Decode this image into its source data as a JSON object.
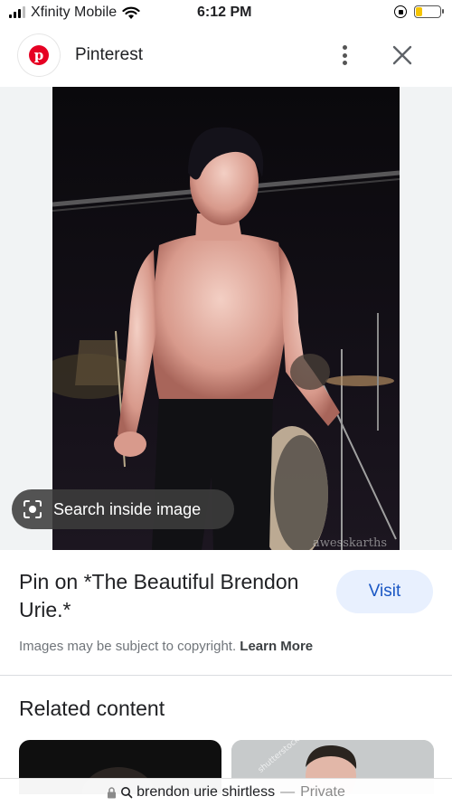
{
  "status_bar": {
    "carrier": "Xfinity Mobile",
    "time": "6:12 PM",
    "battery_level": 0.25,
    "signal_bars": 3
  },
  "header": {
    "app_name": "Pinterest",
    "logo_letter": "p"
  },
  "image": {
    "watermark": "awesskarths",
    "search_label": "Search inside image"
  },
  "pin": {
    "title": "Pin on *The Beautiful Brendon Urie.*",
    "visit_label": "Visit",
    "copyright_text": "Images may be subject to copyright.",
    "learn_more": "Learn More"
  },
  "related": {
    "heading": "Related content",
    "thumb2_watermark": "shutterstock"
  },
  "url_bar": {
    "query": "brendon urie shirtless",
    "separator": "—",
    "mode": "Private"
  },
  "colors": {
    "visit_bg": "#e8f0fe",
    "visit_text": "#1a57c4",
    "pinterest_red": "#e60023",
    "battery": "#f5c400"
  }
}
